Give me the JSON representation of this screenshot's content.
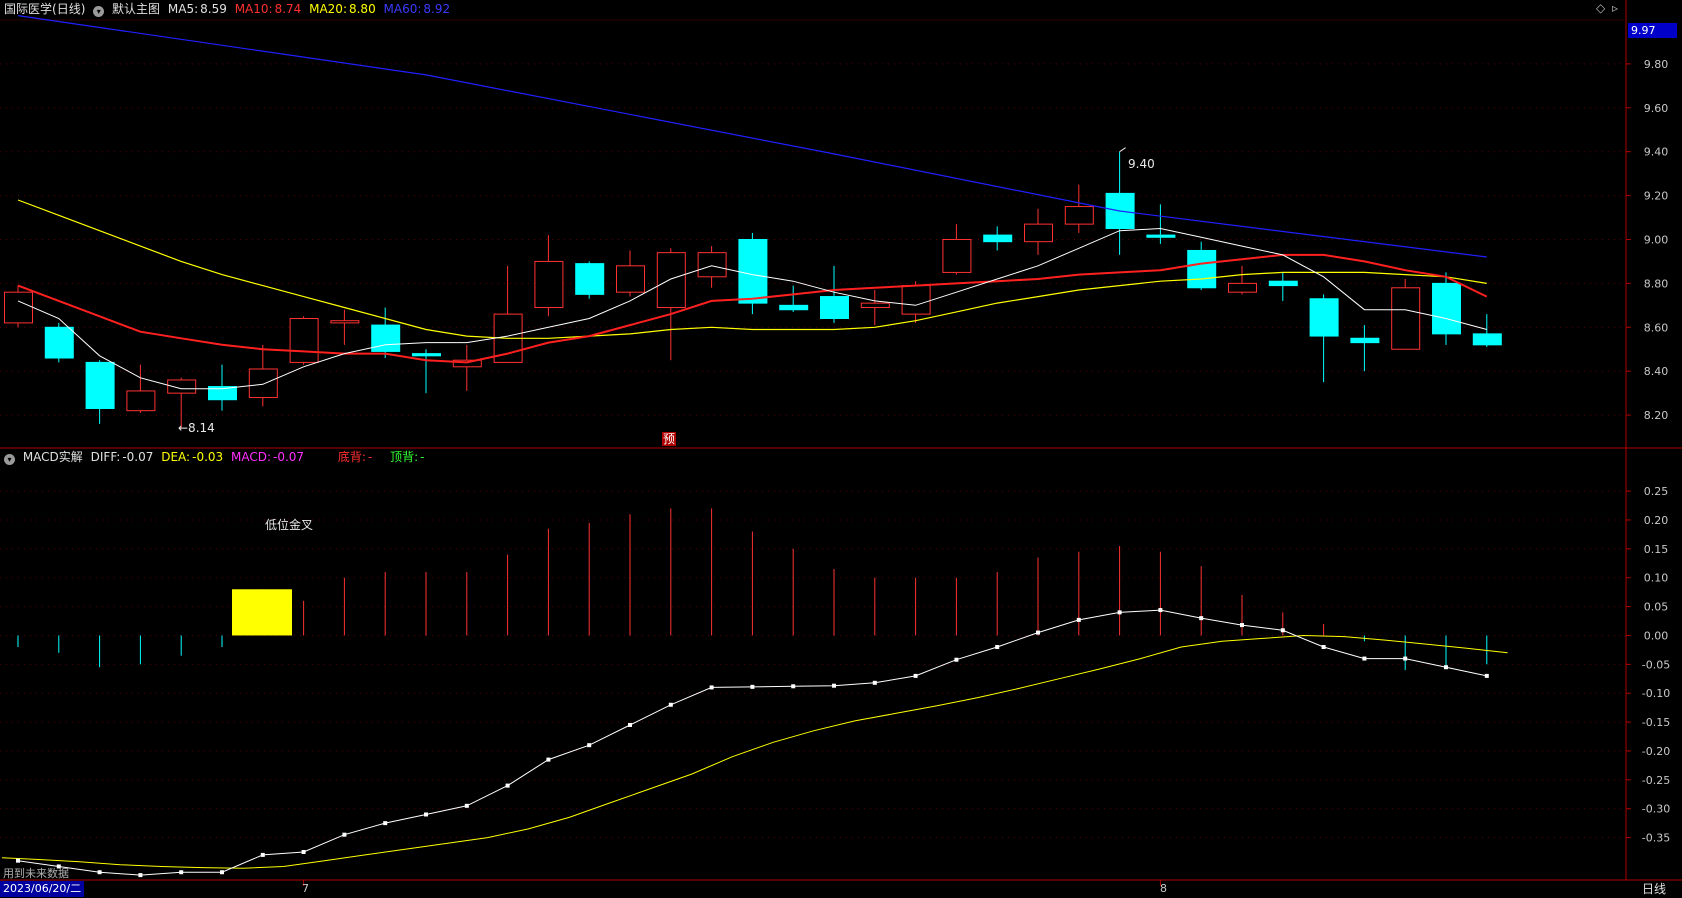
{
  "header": {
    "stock_name": "国际医学",
    "period": "(日线)",
    "main_chart": "默认主图",
    "ma5_label": "MA5:",
    "ma5_value": "8.59",
    "ma10_label": "MA10:",
    "ma10_value": "8.74",
    "ma20_label": "MA20:",
    "ma20_value": "8.80",
    "ma60_label": "MA60:",
    "ma60_value": "8.92",
    "top_price_tag": "9.97"
  },
  "macd_header": {
    "name": "MACD实解",
    "diff_label": "DIFF:",
    "diff_value": "-0.07",
    "dea_label": "DEA:",
    "dea_value": "-0.03",
    "macd_label": "MACD:",
    "macd_value": "-0.07",
    "bottom_div_label": "底背:",
    "bottom_div_value": "-",
    "top_div_label": "顶背:",
    "top_div_value": "-"
  },
  "annotations": {
    "low": "←8.14",
    "high": "9.40",
    "golden_cross": "低位金叉",
    "forecast_marker": "预"
  },
  "footer": {
    "future_data": "用到未来数据",
    "start_date": "2023/06/20/二",
    "month_7": "7",
    "month_8": "8",
    "period_button": "日线"
  },
  "colors": {
    "up": "#ff3232",
    "down": "#00ffff",
    "ma5": "#ffffff",
    "ma10": "#ff2020",
    "ma20": "#ffff00",
    "ma60": "#2020ff",
    "diff": "#ffffff",
    "dea": "#ffff00",
    "frame": "#b00000",
    "golden_cross_box": "#ffff00"
  },
  "chart_data": [
    {
      "type": "candlestick",
      "y_ticks": [
        "9.80",
        "9.60",
        "9.40",
        "9.20",
        "9.00",
        "8.80",
        "8.60",
        "8.40",
        "8.20"
      ],
      "ylim": [
        8.05,
        10.0
      ],
      "candles": [
        {
          "o": 8.62,
          "c": 8.76,
          "h": 8.79,
          "l": 8.6
        },
        {
          "o": 8.6,
          "c": 8.46,
          "h": 8.62,
          "l": 8.44
        },
        {
          "o": 8.44,
          "c": 8.23,
          "h": 8.45,
          "l": 8.16
        },
        {
          "o": 8.22,
          "c": 8.31,
          "h": 8.43,
          "l": 8.21
        },
        {
          "o": 8.3,
          "c": 8.36,
          "h": 8.37,
          "l": 8.14
        },
        {
          "o": 8.33,
          "c": 8.27,
          "h": 8.43,
          "l": 8.22
        },
        {
          "o": 8.28,
          "c": 8.41,
          "h": 8.52,
          "l": 8.24
        },
        {
          "o": 8.44,
          "c": 8.64,
          "h": 8.65,
          "l": 8.43
        },
        {
          "o": 8.62,
          "c": 8.63,
          "h": 8.68,
          "l": 8.52
        },
        {
          "o": 8.61,
          "c": 8.49,
          "h": 8.69,
          "l": 8.46
        },
        {
          "o": 8.48,
          "c": 8.47,
          "h": 8.5,
          "l": 8.3
        },
        {
          "o": 8.42,
          "c": 8.45,
          "h": 8.52,
          "l": 8.31
        },
        {
          "o": 8.44,
          "c": 8.66,
          "h": 8.88,
          "l": 8.44
        },
        {
          "o": 8.69,
          "c": 8.9,
          "h": 9.02,
          "l": 8.65
        },
        {
          "o": 8.89,
          "c": 8.75,
          "h": 8.9,
          "l": 8.73
        },
        {
          "o": 8.76,
          "c": 8.88,
          "h": 8.95,
          "l": 8.74
        },
        {
          "o": 8.69,
          "c": 8.94,
          "h": 8.96,
          "l": 8.45
        },
        {
          "o": 8.83,
          "c": 8.94,
          "h": 8.97,
          "l": 8.78
        },
        {
          "o": 9.0,
          "c": 8.71,
          "h": 9.03,
          "l": 8.66
        },
        {
          "o": 8.7,
          "c": 8.68,
          "h": 8.79,
          "l": 8.67
        },
        {
          "o": 8.74,
          "c": 8.64,
          "h": 8.88,
          "l": 8.62
        },
        {
          "o": 8.69,
          "c": 8.71,
          "h": 8.77,
          "l": 8.61
        },
        {
          "o": 8.66,
          "c": 8.79,
          "h": 8.81,
          "l": 8.62
        },
        {
          "o": 8.85,
          "c": 9.0,
          "h": 9.07,
          "l": 8.84
        },
        {
          "o": 9.02,
          "c": 8.99,
          "h": 9.06,
          "l": 8.95
        },
        {
          "o": 8.99,
          "c": 9.07,
          "h": 9.14,
          "l": 8.93
        },
        {
          "o": 9.07,
          "c": 9.15,
          "h": 9.25,
          "l": 9.03
        },
        {
          "o": 9.21,
          "c": 9.05,
          "h": 9.4,
          "l": 8.93
        },
        {
          "o": 9.02,
          "c": 9.01,
          "h": 9.16,
          "l": 8.98
        },
        {
          "o": 8.95,
          "c": 8.78,
          "h": 8.99,
          "l": 8.77
        },
        {
          "o": 8.76,
          "c": 8.8,
          "h": 8.88,
          "l": 8.75
        },
        {
          "o": 8.81,
          "c": 8.79,
          "h": 8.85,
          "l": 8.72
        },
        {
          "o": 8.73,
          "c": 8.56,
          "h": 8.75,
          "l": 8.35
        },
        {
          "o": 8.55,
          "c": 8.53,
          "h": 8.61,
          "l": 8.4
        },
        {
          "o": 8.5,
          "c": 8.78,
          "h": 8.82,
          "l": 8.5
        },
        {
          "o": 8.8,
          "c": 8.57,
          "h": 8.85,
          "l": 8.52
        },
        {
          "o": 8.57,
          "c": 8.52,
          "h": 8.66,
          "l": 8.51
        }
      ],
      "ma5": [
        8.72,
        8.64,
        8.47,
        8.37,
        8.32,
        8.32,
        8.34,
        8.42,
        8.48,
        8.52,
        8.53,
        8.53,
        8.56,
        8.6,
        8.64,
        8.72,
        8.82,
        8.88,
        8.84,
        8.81,
        8.76,
        8.72,
        8.7,
        8.76,
        8.82,
        8.88,
        8.96,
        9.04,
        9.05,
        9.01,
        8.97,
        8.93,
        8.83,
        8.68,
        8.68,
        8.64,
        8.59
      ],
      "ma10": [
        8.79,
        8.72,
        8.65,
        8.58,
        8.55,
        8.52,
        8.5,
        8.49,
        8.48,
        8.48,
        8.45,
        8.44,
        8.48,
        8.53,
        8.56,
        8.61,
        8.66,
        8.72,
        8.73,
        8.75,
        8.77,
        8.78,
        8.79,
        8.8,
        8.81,
        8.82,
        8.84,
        8.85,
        8.86,
        8.89,
        8.91,
        8.93,
        8.93,
        8.9,
        8.86,
        8.83,
        8.74
      ],
      "ma20": [
        9.18,
        9.11,
        9.04,
        8.97,
        8.9,
        8.84,
        8.79,
        8.74,
        8.69,
        8.64,
        8.59,
        8.56,
        8.55,
        8.55,
        8.56,
        8.57,
        8.59,
        8.6,
        8.59,
        8.59,
        8.59,
        8.6,
        8.63,
        8.67,
        8.71,
        8.74,
        8.77,
        8.79,
        8.81,
        8.82,
        8.84,
        8.85,
        8.85,
        8.85,
        8.84,
        8.83,
        8.8
      ],
      "ma60": {
        "x": [
          0,
          10,
          20,
          27,
          36
        ],
        "y": [
          10.02,
          9.75,
          9.39,
          9.13,
          8.92
        ]
      }
    },
    {
      "type": "macd",
      "y_ticks": [
        "0.25",
        "0.20",
        "0.15",
        "0.10",
        "0.05",
        "0.00",
        "-0.05",
        "-0.10",
        "-0.15",
        "-0.20",
        "-0.25",
        "-0.30",
        "-0.35"
      ],
      "ylim": [
        -0.42,
        0.29
      ],
      "histogram": [
        -0.02,
        -0.03,
        -0.055,
        -0.05,
        -0.035,
        -0.02,
        0.08,
        0.06,
        0.1,
        0.11,
        0.11,
        0.11,
        0.14,
        0.185,
        0.195,
        0.21,
        0.22,
        0.22,
        0.18,
        0.15,
        0.115,
        0.1,
        0.1,
        0.1,
        0.11,
        0.135,
        0.145,
        0.155,
        0.145,
        0.12,
        0.07,
        0.04,
        0.02,
        -0.01,
        -0.06,
        -0.055,
        -0.05,
        0.0
      ],
      "diff": [
        -0.39,
        -0.4,
        -0.41,
        -0.415,
        -0.41,
        -0.41,
        -0.38,
        -0.375,
        -0.345,
        -0.325,
        -0.31,
        -0.295,
        -0.26,
        -0.215,
        -0.19,
        -0.155,
        -0.12,
        -0.09,
        -0.089,
        -0.088,
        -0.087,
        -0.082,
        -0.07,
        -0.042,
        -0.02,
        0.005,
        0.027,
        0.04,
        0.044,
        0.03,
        0.018,
        0.009,
        -0.02,
        -0.04,
        -0.04,
        -0.055,
        -0.07
      ],
      "dea": [
        -0.385,
        -0.388,
        -0.392,
        -0.397,
        -0.4,
        -0.402,
        -0.403,
        -0.4,
        -0.39,
        -0.38,
        -0.37,
        -0.36,
        -0.35,
        -0.335,
        -0.315,
        -0.29,
        -0.265,
        -0.24,
        -0.21,
        -0.185,
        -0.165,
        -0.148,
        -0.135,
        -0.122,
        -0.108,
        -0.092,
        -0.075,
        -0.058,
        -0.04,
        -0.02,
        -0.01,
        -0.005,
        0.0,
        -0.002,
        -0.008,
        -0.015,
        -0.022,
        -0.03
      ]
    }
  ]
}
